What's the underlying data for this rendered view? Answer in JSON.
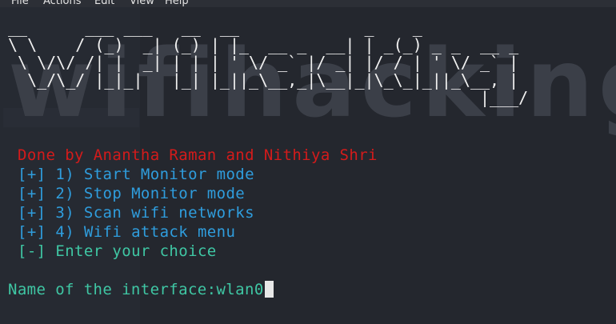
{
  "menubar": {
    "items": [
      "File",
      "Actions",
      "Edit",
      "View",
      "Help"
    ]
  },
  "banner": {
    "word": "wifihacking",
    "ascii_lines": [
      "__      ___ ___   __  __             _    _           ",
      "\\ \\    / (_)  _| (_) | |_  __ _  __| | _(_) _ _  __ _ ",
      " \\ \\/\\/ /| |  _| | | | ' \\/ _` |/ _| |/ / | ' \\/ _` |",
      "  \\_/\\_/ |_|_|   |_| |_||_\\__,_|\\__|_|\\_\\_|_||_\\__, |",
      "                                                 |___/ "
    ]
  },
  "credit": "Done by Anantha Raman and Nithiya Shri",
  "options": [
    "[+] 1) Start Monitor mode",
    "[+] 2) Stop Monitor mode",
    "[+] 3) Scan wifi networks",
    "[+] 4) Wifi attack menu"
  ],
  "choice_prompt": "[-] Enter your choice",
  "interface_prompt": "Name of the interface:",
  "interface_value": "wlan0",
  "colors": {
    "credit": "#d41b1b",
    "options": "#2f9ddd",
    "prompt": "#3fc7a4",
    "background": "#24272e"
  }
}
